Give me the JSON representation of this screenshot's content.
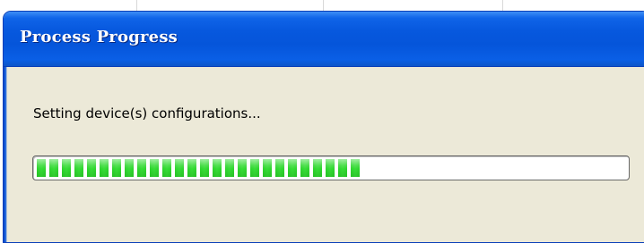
{
  "window": {
    "title": "Process Progress",
    "icons": {
      "progress": "segmented-progress-bar"
    }
  },
  "status": {
    "message": "Setting device(s) configurations..."
  },
  "progress": {
    "fraction": 0.56
  },
  "colors": {
    "title_bar": "#0555da",
    "title_text": "#ffffff",
    "dialog_background": "#ece9d8",
    "progress_fill": "#33d933",
    "progress_track": "#ffffff"
  }
}
